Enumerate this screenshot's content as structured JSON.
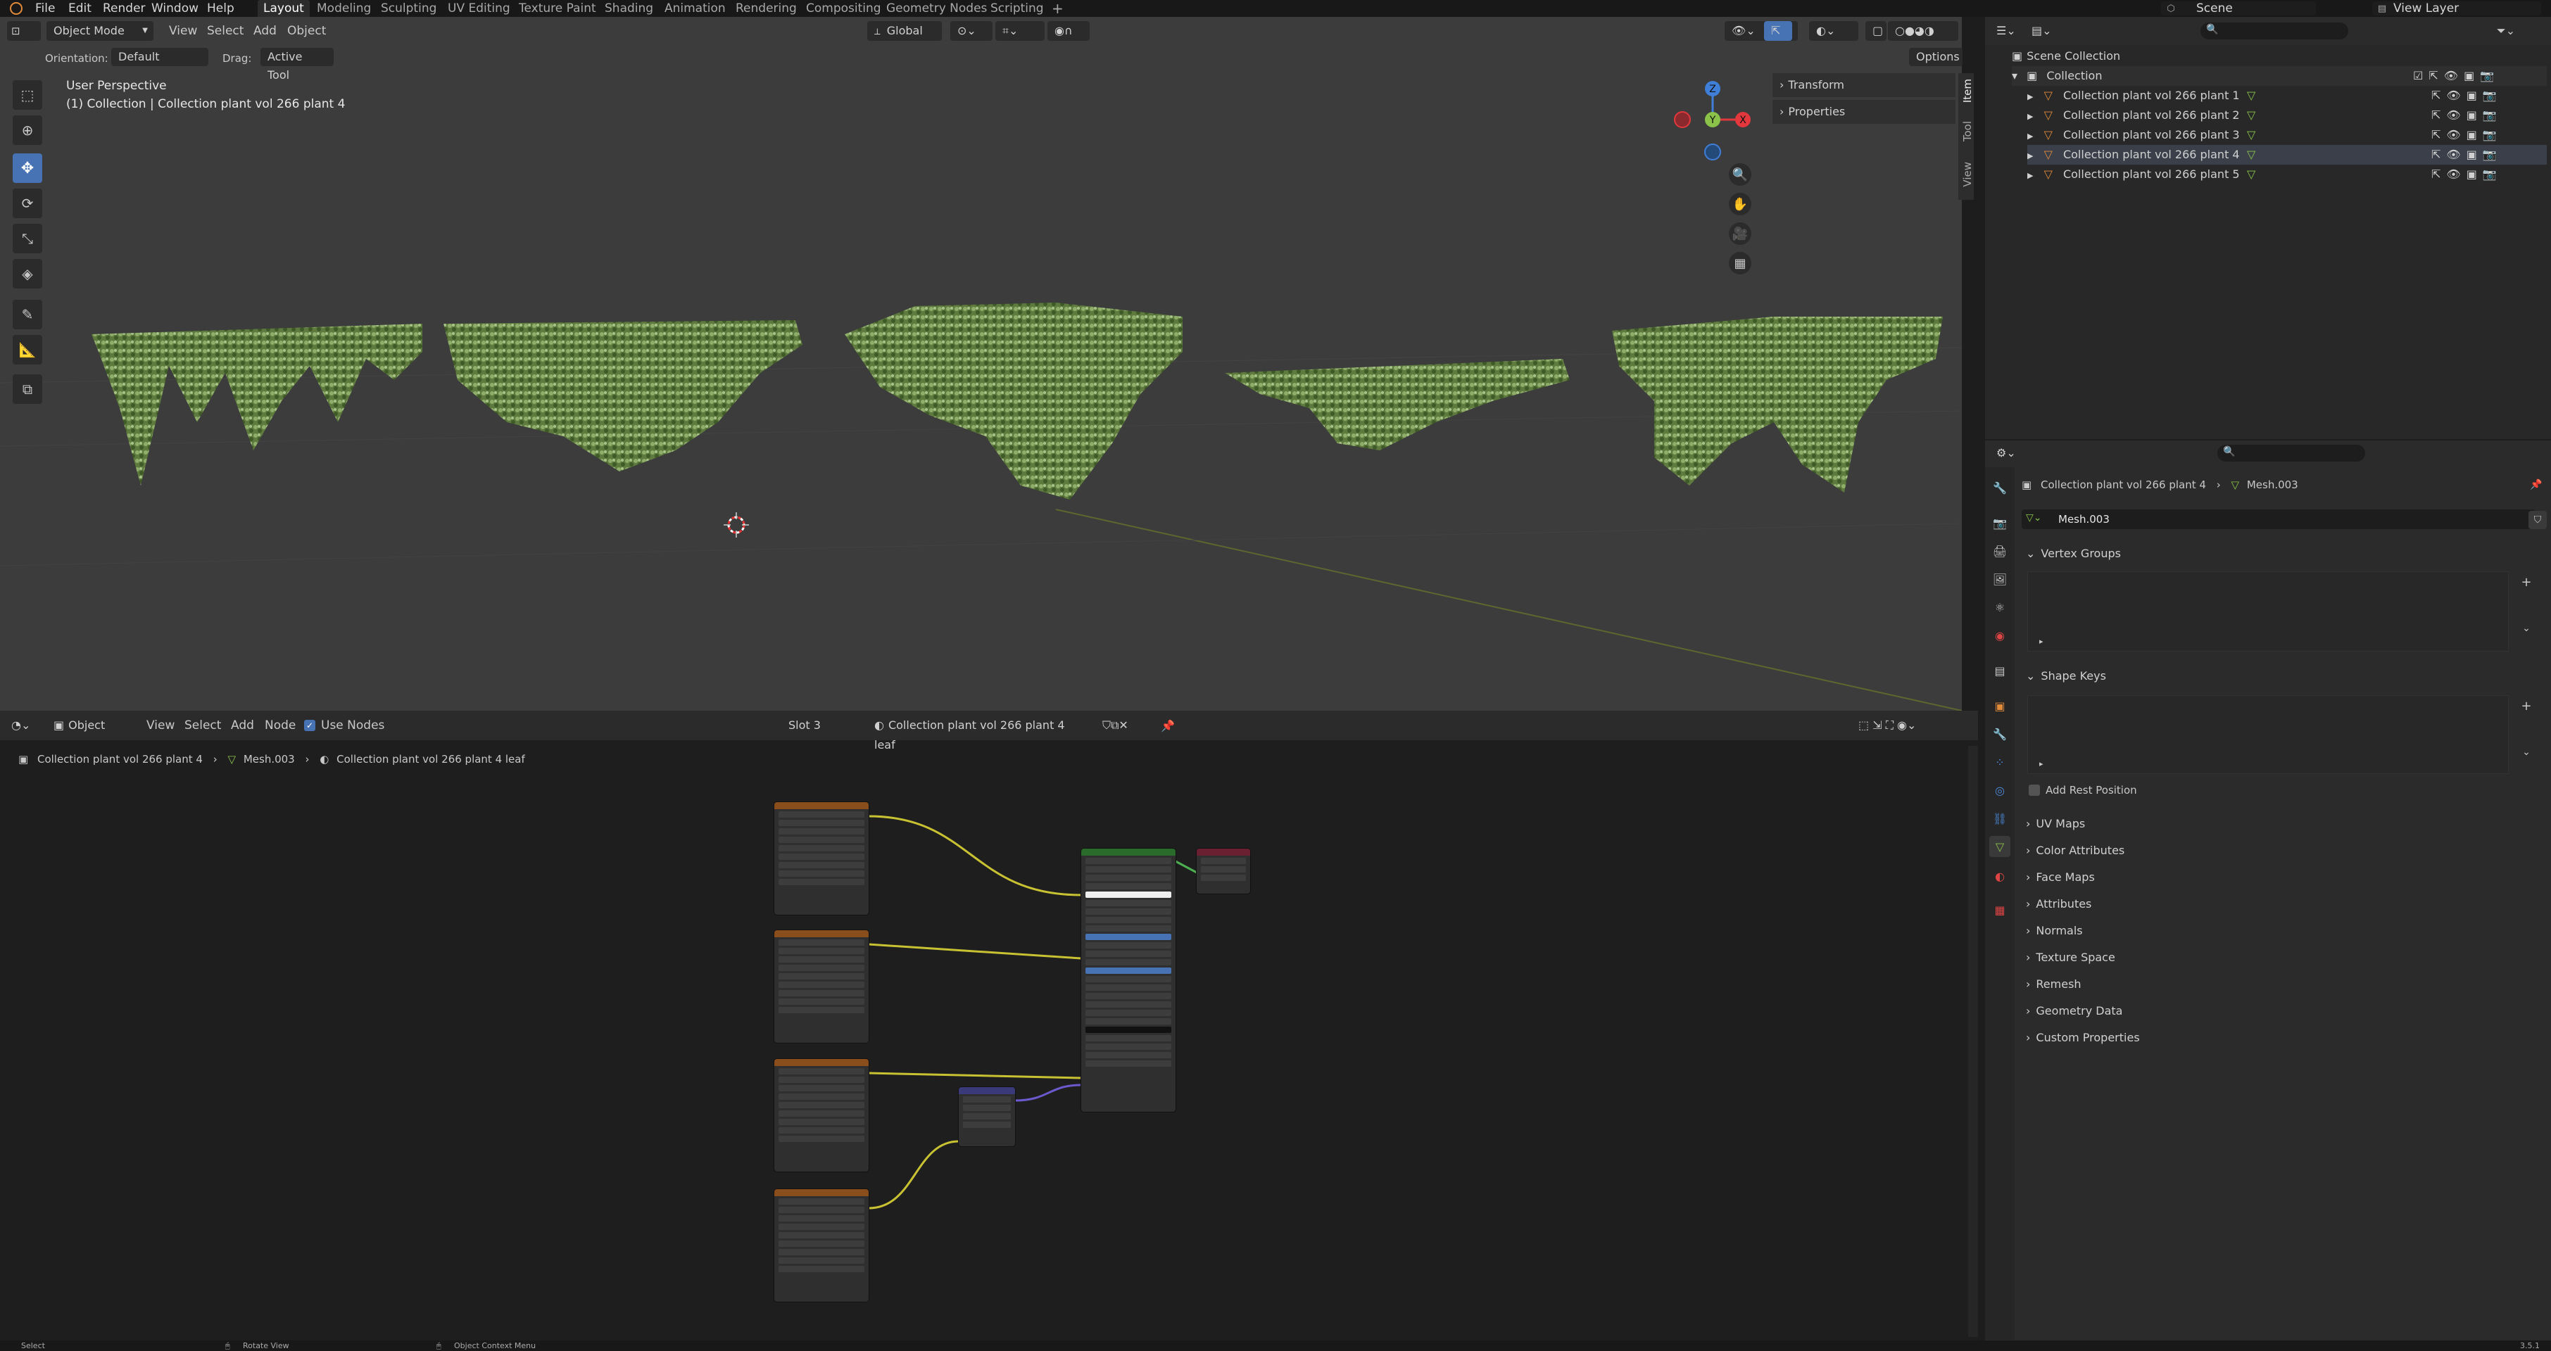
{
  "topbar": {
    "menus": [
      "File",
      "Edit",
      "Render",
      "Window",
      "Help"
    ],
    "workspaces": [
      "Layout",
      "Modeling",
      "Sculpting",
      "UV Editing",
      "Texture Paint",
      "Shading",
      "Animation",
      "Rendering",
      "Compositing",
      "Geometry Nodes",
      "Scripting"
    ],
    "add_tab": "+",
    "scene": "Scene",
    "view_layer": "View Layer"
  },
  "viewport": {
    "mode": "Object Mode",
    "menus": [
      "View",
      "Select",
      "Add",
      "Object"
    ],
    "transform_orientation": "Global",
    "orientation_label": "Orientation:",
    "orientation_value": "Default",
    "drag_label": "Drag:",
    "drag_value": "Active Tool",
    "options": "Options",
    "overlay_title": "User Perspective",
    "overlay_sub": "(1) Collection | Collection plant vol 266 plant 4",
    "gizmo": {
      "z": "Z",
      "y": "Y",
      "x": "X"
    },
    "npanel": [
      "Transform",
      "Properties"
    ],
    "npanel_tabs": [
      "Item",
      "Tool",
      "View"
    ]
  },
  "node_editor": {
    "editor_type": "Object",
    "menus": [
      "View",
      "Select",
      "Add",
      "Node"
    ],
    "use_nodes_label": "Use Nodes",
    "slot": "Slot 3",
    "material": "Collection plant vol 266 plant 4 leaf",
    "breadcrumb": [
      "Collection plant vol 266 plant 4",
      "Mesh.003",
      "Collection plant vol 266 plant 4 leaf"
    ]
  },
  "outliner": {
    "root": "Scene Collection",
    "collection": "Collection",
    "items": [
      "Collection plant vol 266 plant 1",
      "Collection plant vol 266 plant 2",
      "Collection plant vol 266 plant 3",
      "Collection plant vol 266 plant 4",
      "Collection plant vol 266 plant 5"
    ]
  },
  "properties": {
    "object_name": "Collection plant vol 266 plant 4",
    "mesh_name": "Mesh.003",
    "datablock": "Mesh.003",
    "panels_open": [
      "Vertex Groups",
      "Shape Keys"
    ],
    "add_rest_position": "Add Rest Position",
    "panels_closed": [
      "UV Maps",
      "Color Attributes",
      "Face Maps",
      "Attributes",
      "Normals",
      "Texture Space",
      "Remesh",
      "Geometry Data",
      "Custom Properties"
    ]
  },
  "statusbar": {
    "items": [
      "Select",
      "Rotate View",
      "Object Context Menu"
    ],
    "version": "3.5.1"
  },
  "colors": {
    "accent": "#4772b3",
    "axis_x": "#e2383d",
    "axis_y": "#8bc34a",
    "axis_z": "#3f7fd9",
    "texture_node_header": "#8a4d1c",
    "bsdf_header": "#2a6a2a",
    "output_header": "#6a2030",
    "normal_map_header": "#3a3a7a"
  }
}
